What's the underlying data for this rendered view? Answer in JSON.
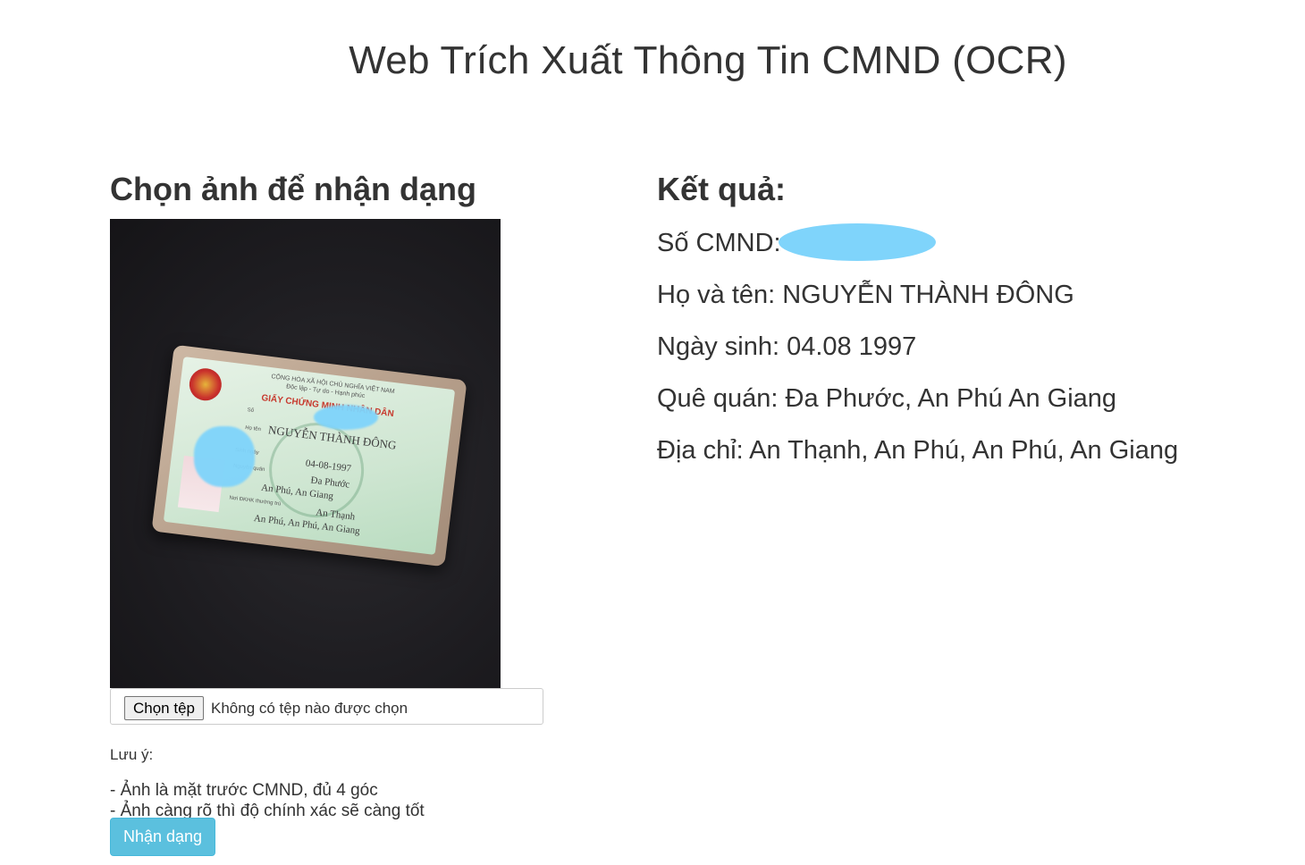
{
  "title": "Web Trích Xuất Thông Tin CMND (OCR)",
  "upload": {
    "heading": "Chọn ảnh để nhận dạng",
    "file_button_label": "Chọn tệp",
    "file_status": "Không có tệp nào được chọn"
  },
  "id_card": {
    "country_header_1": "CỘNG HÒA XÃ HỘI CHỦ NGHĨA VIỆT NAM",
    "country_header_2": "Độc lập - Tự do - Hạnh phúc",
    "card_type": "GIẤY CHỨNG MINH NHÂN DÂN",
    "number_label": "Số",
    "name_label": "Họ tên",
    "name_value": "NGUYỄN THÀNH ĐÔNG",
    "dob_label": "Sinh ngày",
    "dob_value": "04-08-1997",
    "hometown_label": "Nguyên quán",
    "hometown_value_1": "Đa Phước",
    "hometown_value_2": "An Phú, An Giang",
    "residence_label": "Nơi ĐKHK thường trú",
    "residence_value_1": "An Thạnh",
    "residence_value_2": "An Phú, An Phú, An Giang"
  },
  "notes": {
    "label": "Lưu ý:",
    "lines": [
      "- Ảnh là mặt trước CMND, đủ 4 góc",
      "- Ảnh càng rõ thì độ chính xác sẽ càng tốt"
    ]
  },
  "submit_label": "Nhận dạng",
  "result": {
    "heading": "Kết quả:",
    "id_number_label": "Số CMND:",
    "name": "Họ và tên: NGUYỄN THÀNH ĐÔNG",
    "dob": "Ngày sinh: 04.08 1997",
    "hometown": "Quê quán: Đa Phước, An Phú An Giang",
    "address": "Địa chỉ: An Thạnh, An Phú, An Phú, An Giang"
  },
  "colors": {
    "redaction": "#7fd4fb",
    "primary_button": "#5bc0de",
    "text": "#333333"
  }
}
